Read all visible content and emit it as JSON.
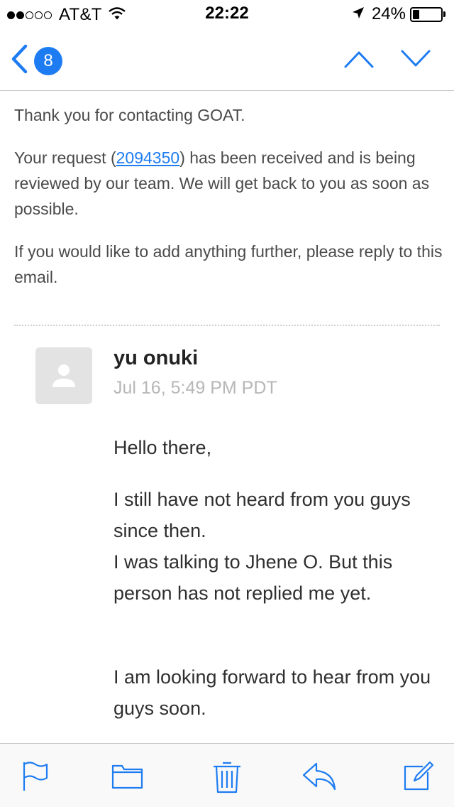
{
  "status_bar": {
    "carrier": "AT&T",
    "signal_bars_filled": 2,
    "signal_bars_total": 5,
    "time": "22:22",
    "battery_percent_label": "24%",
    "battery_level": 0.24
  },
  "nav": {
    "back_badge_count": "8",
    "icons": {
      "back": "chevron-left-icon",
      "previous": "chevron-up-icon",
      "next": "chevron-down-icon"
    }
  },
  "email": {
    "quoted": {
      "line1": "Thank you for contacting GOAT.",
      "request_prefix": "Your request (",
      "request_id": "2094350",
      "request_suffix": ") has been received and is being reviewed by our team. We will get back to you as soon as possible.",
      "line3": "If you would like to add anything further, please reply to this email."
    },
    "message": {
      "sender_name": "yu onuki",
      "date": "Jul 16, 5:49 PM PDT",
      "greeting": "Hello there,",
      "para_line1": "I still have not heard from you guys since then.",
      "para_line2": "I was talking to Jhene O. But this person has not replied me yet.",
      "closing": "I am looking forward to hear from you guys soon."
    }
  },
  "toolbar": {
    "icons": [
      "flag-icon",
      "folder-icon",
      "trash-icon",
      "reply-icon",
      "compose-icon"
    ]
  },
  "colors": {
    "accent": "#1e7cf2",
    "text": "#3a3a3a",
    "muted": "#b7b7b7"
  }
}
